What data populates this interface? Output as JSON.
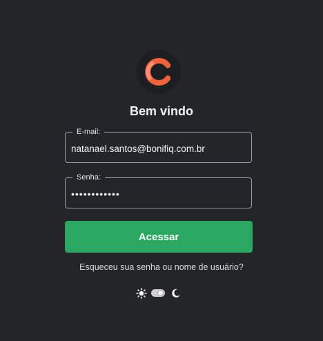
{
  "logo": {
    "icon": "c-logo-icon",
    "colors": {
      "main": "#f0623a",
      "highlight": "#ff9a83",
      "background": "#1d1e21"
    }
  },
  "heading": "Bem vindo",
  "form": {
    "email": {
      "label": "E-mail:",
      "value": "natanael.santos@bonifiq.com.br"
    },
    "password": {
      "label": "Senha:",
      "value": "••••••••••••"
    },
    "submit_label": "Acessar",
    "forgot_label": "Esqueceu sua senha ou nome de usuário?"
  },
  "theme_toggle": {
    "left_icon": "sun-icon",
    "right_icon": "moon-icon",
    "mode": "dark"
  },
  "colors": {
    "background": "#242528",
    "accent": "#2aa861",
    "text": "#f2f2f2",
    "field_border": "#9a9ca3"
  }
}
